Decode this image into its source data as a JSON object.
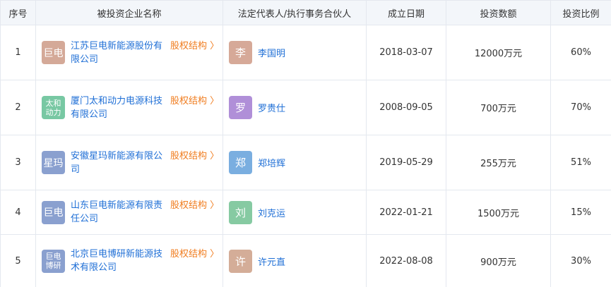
{
  "headers": {
    "index": "序号",
    "company": "被投资企业名称",
    "representative": "法定代表人/执行事务合伙人",
    "founded": "成立日期",
    "amount": "投资数额",
    "ratio": "投资比例"
  },
  "equity_label": "股权结构 〉",
  "rows": [
    {
      "index": "1",
      "logo_lines": [
        "巨电"
      ],
      "logo_color": "#d4a998",
      "company_lines": [
        "江苏巨电新能源股份有",
        "限公司"
      ],
      "avatar": "李",
      "avatar_color": "#d6a998",
      "person": "李国明",
      "founded": "2018-03-07",
      "amount": "12000万元",
      "ratio": "60%"
    },
    {
      "index": "2",
      "logo_lines": [
        "太和",
        "动力"
      ],
      "logo_color": "#78c8a3",
      "company_lines": [
        "厦门太和动力电源科技",
        "有限公司"
      ],
      "avatar": "罗",
      "avatar_color": "#b08fd8",
      "person": "罗贵仕",
      "founded": "2008-09-05",
      "amount": "700万元",
      "ratio": "70%"
    },
    {
      "index": "3",
      "logo_lines": [
        "星玛"
      ],
      "logo_color": "#8aa0cf",
      "company_lines": [
        "安徽星玛新能源有限公司"
      ],
      "avatar": "郑",
      "avatar_color": "#7aaee0",
      "person": "郑培辉",
      "founded": "2019-05-29",
      "amount": "255万元",
      "ratio": "51%"
    },
    {
      "index": "4",
      "logo_lines": [
        "巨电"
      ],
      "logo_color": "#8aa0cf",
      "company_lines": [
        "山东巨电新能源有限责",
        "任公司"
      ],
      "avatar": "刘",
      "avatar_color": "#86caa2",
      "person": "刘克运",
      "founded": "2022-01-21",
      "amount": "1500万元",
      "ratio": "15%"
    },
    {
      "index": "5",
      "logo_lines": [
        "巨电",
        "博研"
      ],
      "logo_color": "#8aa0cf",
      "company_lines": [
        "北京巨电博研新能源技",
        "术有限公司"
      ],
      "avatar": "许",
      "avatar_color": "#d4ad98",
      "person": "许元直",
      "founded": "2022-08-08",
      "amount": "900万元",
      "ratio": "30%"
    }
  ]
}
